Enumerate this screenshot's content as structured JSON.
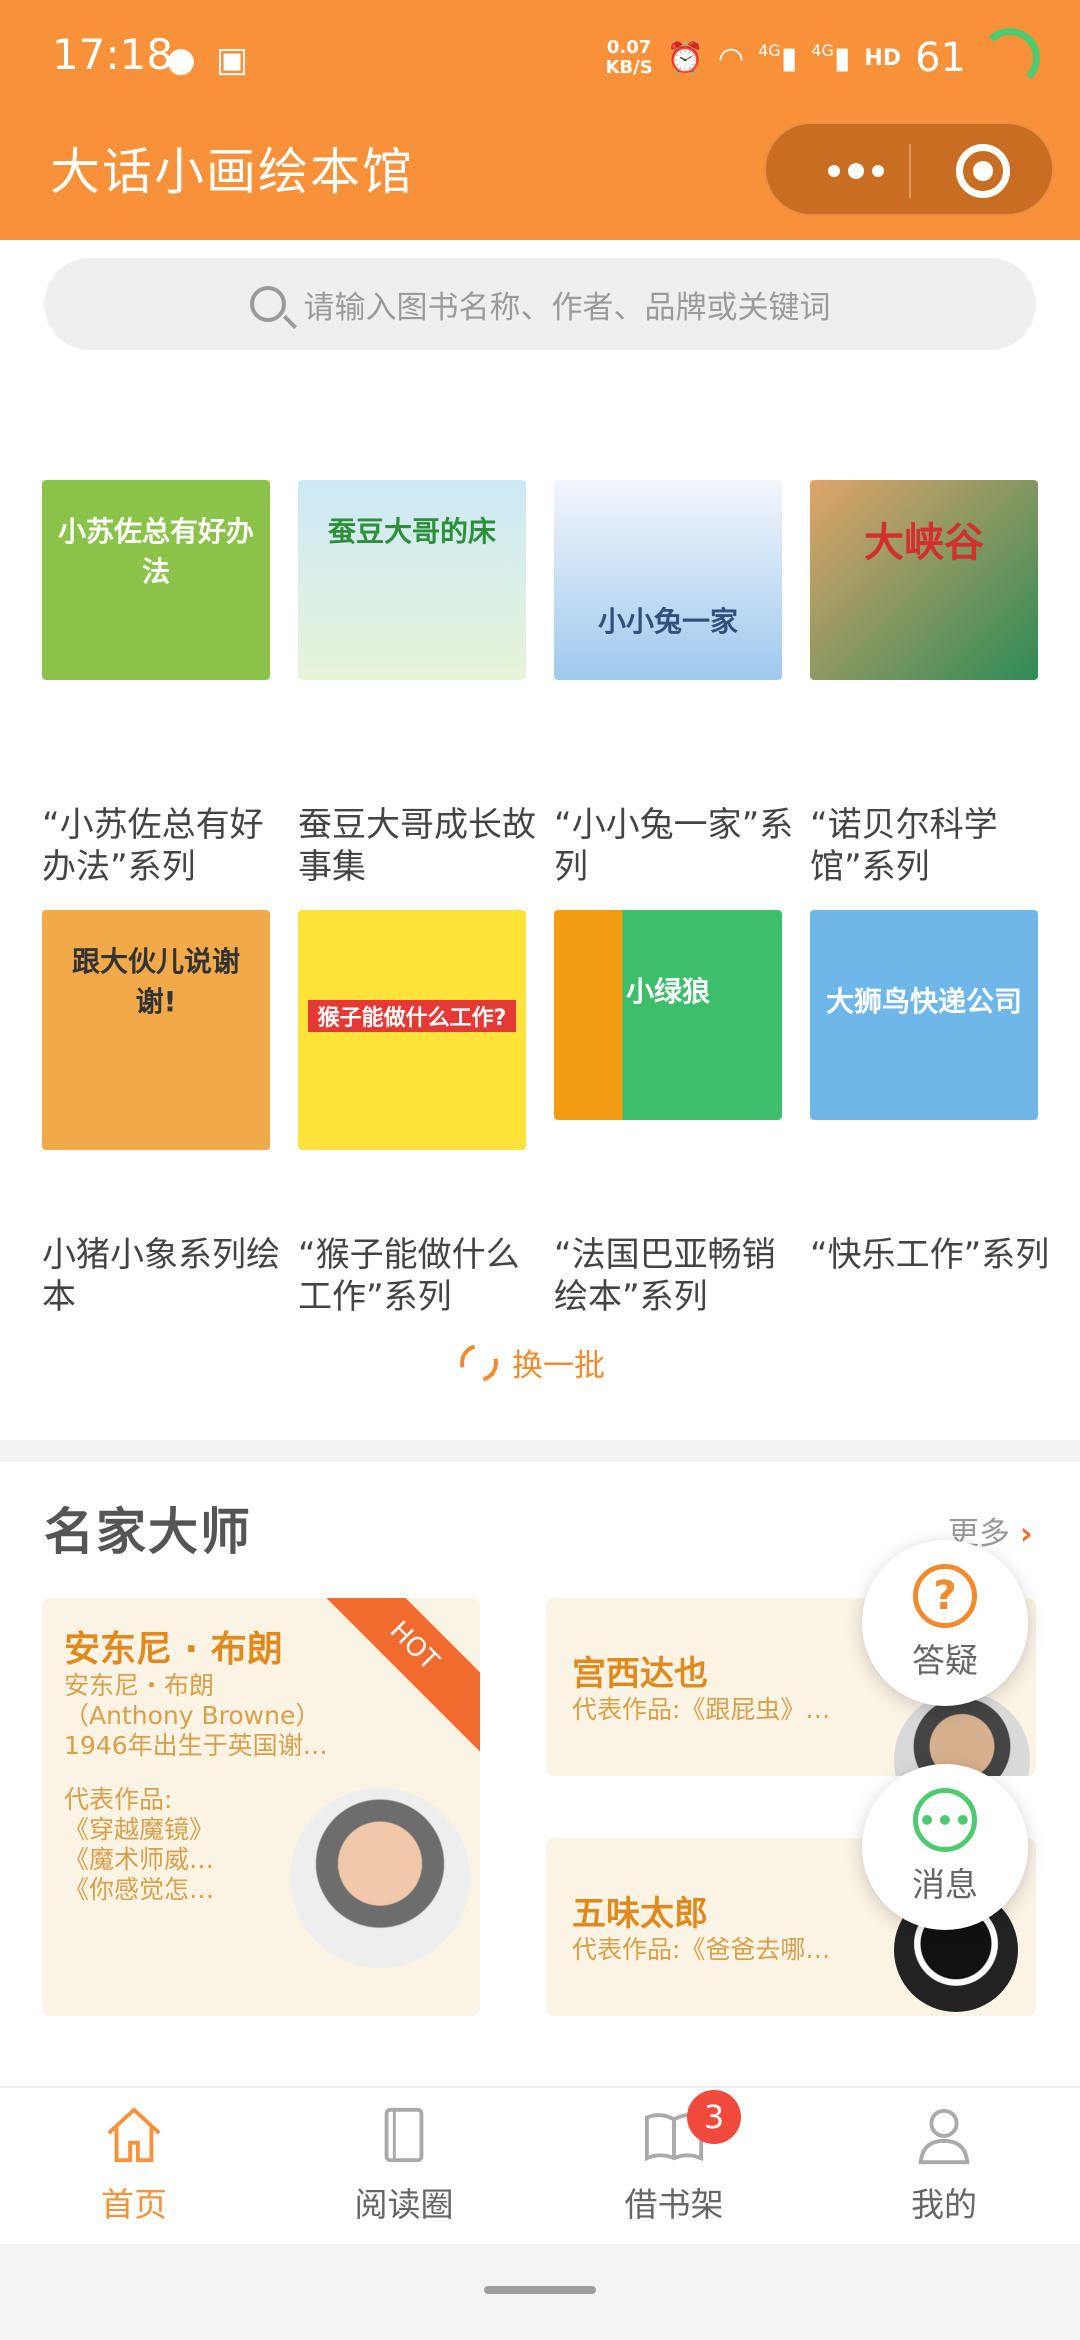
{
  "status_bar": {
    "time": "17:18",
    "speed_value": "0.07",
    "speed_unit": "KB/S",
    "battery": "61",
    "network_a": "4G",
    "network_b": "4G"
  },
  "header": {
    "title": "大话小画绘本馆"
  },
  "search": {
    "placeholder": "请输入图书名称、作者、品牌或关键词"
  },
  "books": [
    {
      "title": "“小苏佐总有好办法”系列",
      "cover_text": "小苏佐总有好办法",
      "cover_color": "#8BC34A"
    },
    {
      "title": "蚕豆大哥成长故事集",
      "cover_text": "蚕豆大哥的床",
      "cover_color": "#A7D8F0"
    },
    {
      "title": "“小小兔一家”系列",
      "cover_text": "小小兔一家",
      "cover_color": "#9FC9EE"
    },
    {
      "title": "“诺贝尔科学馆”系列",
      "cover_text": "大峡谷",
      "cover_color": "#E0A46A"
    },
    {
      "title": "小猪小象系列绘本",
      "cover_text": "跟大伙儿说谢谢!",
      "cover_color": "#F2A94A"
    },
    {
      "title": "“猴子能做什么工作”系列",
      "cover_text": "猴子能做什么工作?",
      "cover_color": "#FFE23A"
    },
    {
      "title": "“法国巴亚畅销绘本”系列",
      "cover_text": "小绿狼",
      "cover_color": "#3DBE6A"
    },
    {
      "title": "“快乐工作”系列",
      "cover_text": "大狮鸟快递公司",
      "cover_color": "#6FB7E8"
    }
  ],
  "refresh_label": "换一批",
  "masters": {
    "title": "名家大师",
    "more_label": "更多",
    "hot_label": "HOT",
    "featured": {
      "name": "安东尼 · 布朗",
      "lines": [
        "安东尼・布朗",
        "（Anthony Browne）",
        "1946年出生于英国谢…"
      ],
      "works_label": "代表作品:",
      "works": [
        "《穿越魔镜》",
        "《魔术师威…",
        "《你感觉怎…"
      ]
    },
    "others": [
      {
        "name": "宫西达也",
        "works": "代表作品:《跟屁虫》…"
      },
      {
        "name": "五味太郎",
        "works": "代表作品:《爸爸去哪…"
      }
    ]
  },
  "floating": [
    {
      "icon": "question-icon",
      "label": "答疑"
    },
    {
      "icon": "message-icon",
      "label": "消息"
    }
  ],
  "tabbar": {
    "items": [
      {
        "label": "首页",
        "icon": "home-icon",
        "active": true
      },
      {
        "label": "阅读圈",
        "icon": "book-icon",
        "active": false
      },
      {
        "label": "借书架",
        "icon": "open-book-icon",
        "active": false,
        "badge": "3"
      },
      {
        "label": "我的",
        "icon": "person-icon",
        "active": false
      }
    ]
  },
  "colors": {
    "primary": "#F7913A",
    "accent": "#F26B2E",
    "card_bg": "#FBF3E4",
    "badge": "#EF4A3C"
  }
}
